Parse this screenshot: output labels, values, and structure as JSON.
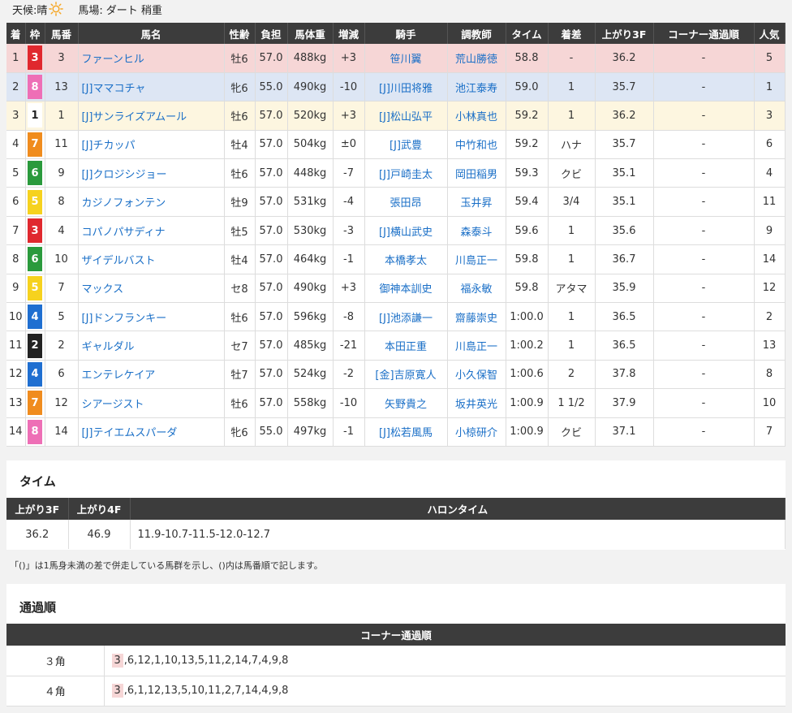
{
  "weather": {
    "label": "天候:",
    "value": "晴",
    "track_label": "馬場:",
    "track_value": "ダート 稍重"
  },
  "results": {
    "headers": [
      "着",
      "枠",
      "馬番",
      "馬名",
      "性齢",
      "負担",
      "馬体重",
      "増減",
      "騎手",
      "調教師",
      "タイム",
      "着差",
      "上がり3F",
      "コーナー通過順",
      "人気"
    ],
    "rows": [
      {
        "pos": "1",
        "waku": "3",
        "num": "3",
        "name": "ファーンヒル",
        "sexage": "牡6",
        "weight": "57.0",
        "body": "488kg",
        "diff": "+3",
        "jockey": "笹川翼",
        "trainer": "荒山勝徳",
        "time": "58.8",
        "margin": "-",
        "last3f": "36.2",
        "corner": "-",
        "pop": "5"
      },
      {
        "pos": "2",
        "waku": "8",
        "num": "13",
        "name": "[J]ママコチャ",
        "sexage": "牝6",
        "weight": "55.0",
        "body": "490kg",
        "diff": "-10",
        "jockey": "[J]川田将雅",
        "trainer": "池江泰寿",
        "time": "59.0",
        "margin": "1",
        "last3f": "35.7",
        "corner": "-",
        "pop": "1"
      },
      {
        "pos": "3",
        "waku": "1",
        "num": "1",
        "name": "[J]サンライズアムール",
        "sexage": "牡6",
        "weight": "57.0",
        "body": "520kg",
        "diff": "+3",
        "jockey": "[J]松山弘平",
        "trainer": "小林真也",
        "time": "59.2",
        "margin": "1",
        "last3f": "36.2",
        "corner": "-",
        "pop": "3"
      },
      {
        "pos": "4",
        "waku": "7",
        "num": "11",
        "name": "[J]チカッパ",
        "sexage": "牡4",
        "weight": "57.0",
        "body": "504kg",
        "diff": "±0",
        "jockey": "[J]武豊",
        "trainer": "中竹和也",
        "time": "59.2",
        "margin": "ハナ",
        "last3f": "35.7",
        "corner": "-",
        "pop": "6"
      },
      {
        "pos": "5",
        "waku": "6",
        "num": "9",
        "name": "[J]クロジシジョー",
        "sexage": "牡6",
        "weight": "57.0",
        "body": "448kg",
        "diff": "-7",
        "jockey": "[J]戸崎圭太",
        "trainer": "岡田稲男",
        "time": "59.3",
        "margin": "クビ",
        "last3f": "35.1",
        "corner": "-",
        "pop": "4"
      },
      {
        "pos": "6",
        "waku": "5",
        "num": "8",
        "name": "カジノフォンテン",
        "sexage": "牡9",
        "weight": "57.0",
        "body": "531kg",
        "diff": "-4",
        "jockey": "張田昂",
        "trainer": "玉井昇",
        "time": "59.4",
        "margin": "3/4",
        "last3f": "35.1",
        "corner": "-",
        "pop": "11"
      },
      {
        "pos": "7",
        "waku": "3",
        "num": "4",
        "name": "コパノパサディナ",
        "sexage": "牡5",
        "weight": "57.0",
        "body": "530kg",
        "diff": "-3",
        "jockey": "[J]横山武史",
        "trainer": "森泰斗",
        "time": "59.6",
        "margin": "1",
        "last3f": "35.6",
        "corner": "-",
        "pop": "9"
      },
      {
        "pos": "8",
        "waku": "6",
        "num": "10",
        "name": "ザイデルバスト",
        "sexage": "牡4",
        "weight": "57.0",
        "body": "464kg",
        "diff": "-1",
        "jockey": "本橋孝太",
        "trainer": "川島正一",
        "time": "59.8",
        "margin": "1",
        "last3f": "36.7",
        "corner": "-",
        "pop": "14"
      },
      {
        "pos": "9",
        "waku": "5",
        "num": "7",
        "name": "マックス",
        "sexage": "セ8",
        "weight": "57.0",
        "body": "490kg",
        "diff": "+3",
        "jockey": "御神本訓史",
        "trainer": "福永敏",
        "time": "59.8",
        "margin": "アタマ",
        "last3f": "35.9",
        "corner": "-",
        "pop": "12"
      },
      {
        "pos": "10",
        "waku": "4",
        "num": "5",
        "name": "[J]ドンフランキー",
        "sexage": "牡6",
        "weight": "57.0",
        "body": "596kg",
        "diff": "-8",
        "jockey": "[J]池添謙一",
        "trainer": "齋藤崇史",
        "time": "1:00.0",
        "margin": "1",
        "last3f": "36.5",
        "corner": "-",
        "pop": "2"
      },
      {
        "pos": "11",
        "waku": "2",
        "num": "2",
        "name": "ギャルダル",
        "sexage": "セ7",
        "weight": "57.0",
        "body": "485kg",
        "diff": "-21",
        "jockey": "本田正重",
        "trainer": "川島正一",
        "time": "1:00.2",
        "margin": "1",
        "last3f": "36.5",
        "corner": "-",
        "pop": "13"
      },
      {
        "pos": "12",
        "waku": "4",
        "num": "6",
        "name": "エンテレケイア",
        "sexage": "牡7",
        "weight": "57.0",
        "body": "524kg",
        "diff": "-2",
        "jockey": "[金]吉原寛人",
        "trainer": "小久保智",
        "time": "1:00.6",
        "margin": "2",
        "last3f": "37.8",
        "corner": "-",
        "pop": "8"
      },
      {
        "pos": "13",
        "waku": "7",
        "num": "12",
        "name": "シアージスト",
        "sexage": "牡6",
        "weight": "57.0",
        "body": "558kg",
        "diff": "-10",
        "jockey": "矢野貴之",
        "trainer": "坂井英光",
        "time": "1:00.9",
        "margin": "1 1/2",
        "last3f": "37.9",
        "corner": "-",
        "pop": "10"
      },
      {
        "pos": "14",
        "waku": "8",
        "num": "14",
        "name": "[J]テイエムスパーダ",
        "sexage": "牝6",
        "weight": "55.0",
        "body": "497kg",
        "diff": "-1",
        "jockey": "[J]松若風馬",
        "trainer": "小椋研介",
        "time": "1:00.9",
        "margin": "クビ",
        "last3f": "37.1",
        "corner": "-",
        "pop": "7"
      }
    ]
  },
  "waku_colors": {
    "1": {
      "bg": "#ffffff",
      "fg": "#222222"
    },
    "2": {
      "bg": "#222222",
      "fg": "#ffffff"
    },
    "3": {
      "bg": "#e0282e",
      "fg": "#ffffff"
    },
    "4": {
      "bg": "#1f6fd1",
      "fg": "#ffffff"
    },
    "5": {
      "bg": "#f6d21e",
      "fg": "#ffffff"
    },
    "6": {
      "bg": "#2a9a3c",
      "fg": "#ffffff"
    },
    "7": {
      "bg": "#f08c1e",
      "fg": "#ffffff"
    },
    "8": {
      "bg": "#ee6fb6",
      "fg": "#ffffff"
    }
  },
  "time_section": {
    "title": "タイム",
    "headers": [
      "上がり3F",
      "上がり4F",
      "ハロンタイム"
    ],
    "values": [
      "36.2",
      "46.9",
      "11.9-10.7-11.5-12.0-12.7"
    ]
  },
  "note": "「()」は1馬身未満の差で併走している馬群を示し、()内は馬番順で記します。",
  "passing": {
    "title": "通過順",
    "header": "コーナー通過順",
    "rows": [
      {
        "corner": "３角",
        "lead": "3",
        "rest": ",6,12,1,10,13,5,11,2,14,7,4,9,8"
      },
      {
        "corner": "４角",
        "lead": "3",
        "rest": ",6,1,12,13,5,10,11,2,7,14,4,9,8"
      }
    ]
  }
}
